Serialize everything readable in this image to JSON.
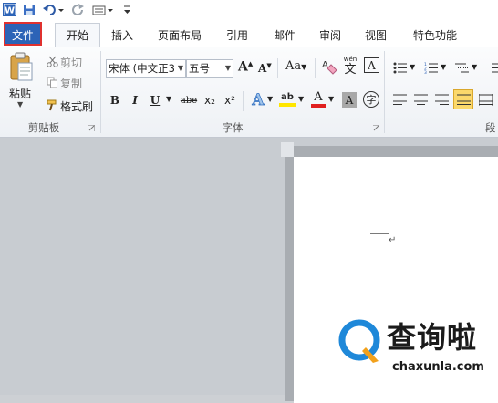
{
  "quick_access": {
    "word_icon": "W",
    "save_icon": "save-icon",
    "undo_icon": "undo-icon",
    "redo_icon": "redo-icon",
    "customize_icon": "customize-icon"
  },
  "tabs": {
    "file": "文件",
    "home": "开始",
    "insert": "插入",
    "page_layout": "页面布局",
    "references": "引用",
    "mailings": "邮件",
    "review": "审阅",
    "view": "视图",
    "special": "特色功能"
  },
  "clipboard": {
    "paste": "粘贴",
    "cut": "剪切",
    "copy": "复制",
    "format_painter": "格式刷",
    "group_label": "剪贴板"
  },
  "font": {
    "font_name": "宋体 (中文正3",
    "font_size": "五号",
    "grow": "A",
    "shrink": "A",
    "change_case": "Aa",
    "pinyin": "wén",
    "pinyin_char": "文",
    "char_border": "A",
    "bold": "B",
    "italic": "I",
    "underline": "U",
    "strike": "abe",
    "subscript": "x₂",
    "superscript": "x²",
    "text_effect": "A",
    "highlight": "ab",
    "font_color": "A",
    "char_shading": "A",
    "enclose_char": "字",
    "group_label": "字体"
  },
  "paragraph": {
    "group_label": "段"
  },
  "watermark": {
    "brand": "查询啦",
    "url": "chaxunla.com"
  },
  "colors": {
    "file_tab": "#2c63b7",
    "highlight_box": "#e0312f",
    "logo_blue": "#1e88d9",
    "logo_orange": "#f2a11c"
  }
}
